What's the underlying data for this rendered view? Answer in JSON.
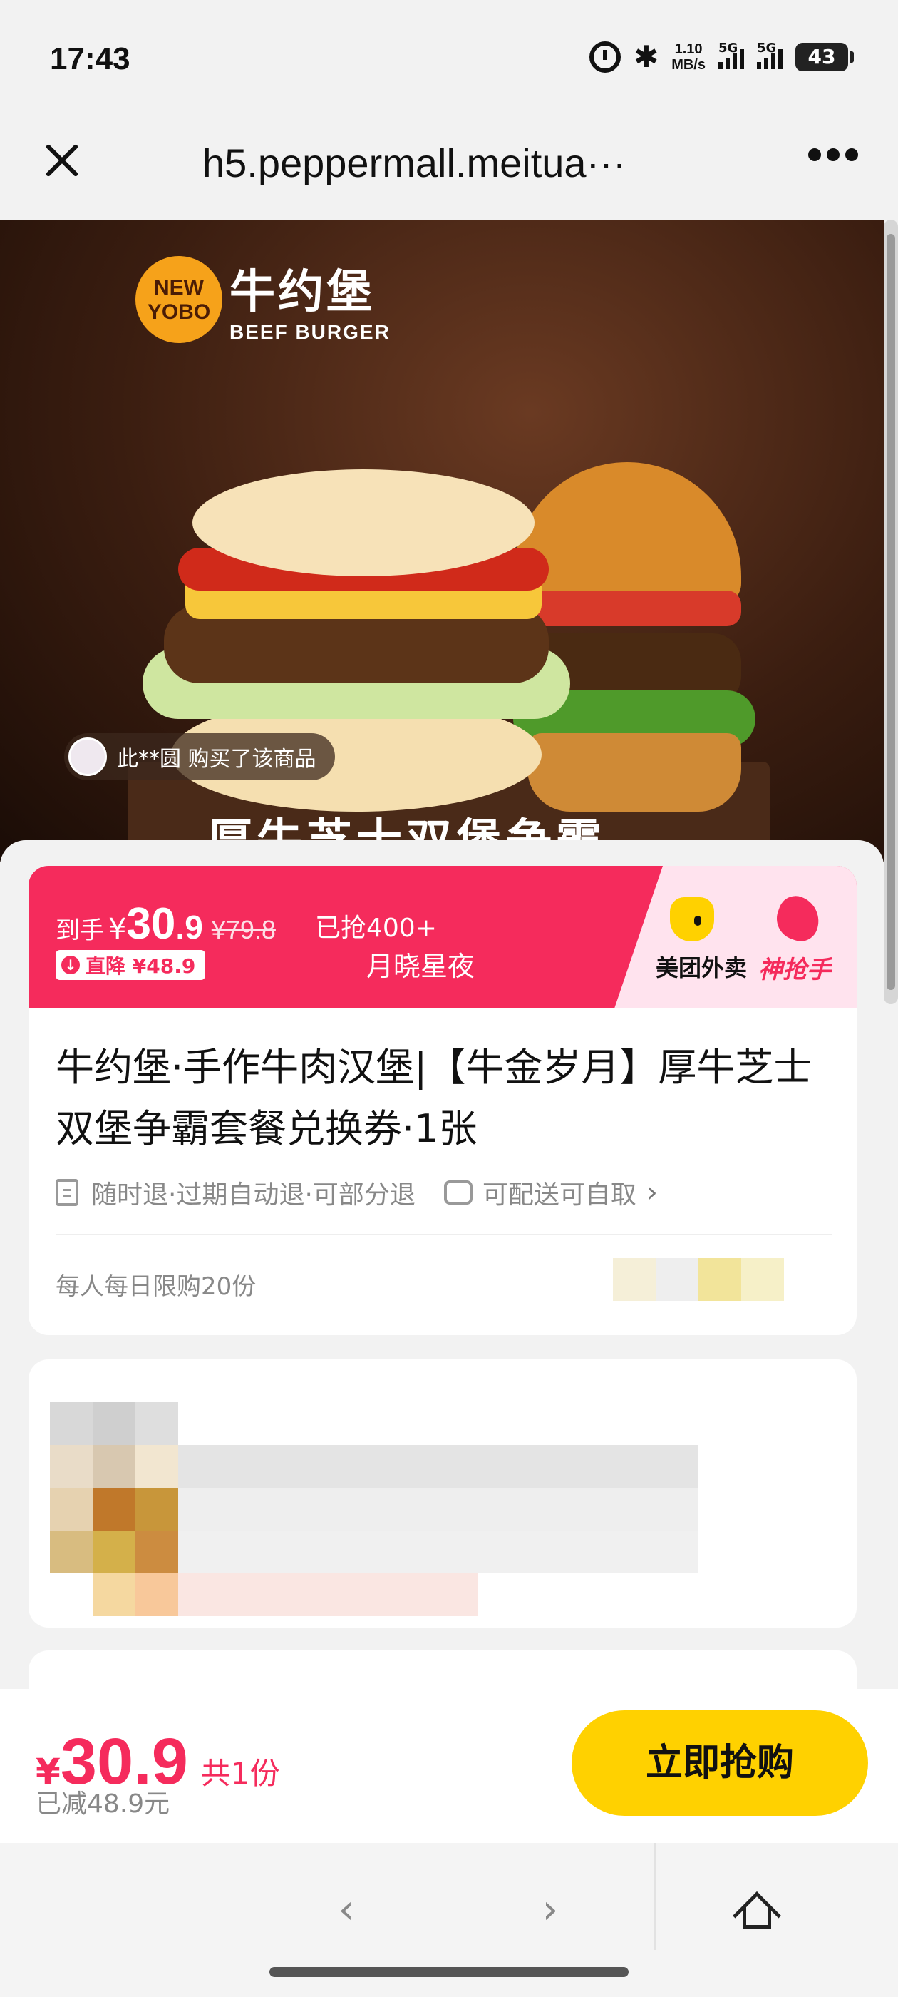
{
  "status_bar": {
    "time": "17:43",
    "net_speed_top": "1.10",
    "net_speed_unit": "MB/s",
    "signal1_label": "5G",
    "signal2_label": "5G",
    "battery": "43"
  },
  "browser": {
    "url": "h5.peppermall.meitua···",
    "close_icon": "close-icon",
    "more_icon": "more-icon"
  },
  "hero": {
    "logo_badge": "NEW YOBO",
    "logo_cn": "牛约堡",
    "logo_en": "BEEF BURGER",
    "buyer_notice": "此**圆 购买了该商品",
    "caption": "厚牛芝士双堡争霸"
  },
  "banner": {
    "price_label": "到手",
    "currency": "¥",
    "price_int": "30",
    "price_dec": ".9",
    "original_price": "¥79.8",
    "sold": "已抢400+",
    "drop_label": "直降 ¥48.9",
    "slogan": "月晓星夜",
    "brand_waimai": "美团外卖",
    "brand_shenqiangshou": "神抢手"
  },
  "product": {
    "title": "牛约堡·手作牛肉汉堡|【牛金岁月】厚牛芝士双堡争霸套餐兑换券·1张",
    "refund_policy": "随时退·过期自动退·可部分退",
    "delivery": "可配送可自取",
    "limit": "每人每日限购20份"
  },
  "footer": {
    "currency": "¥",
    "price": "30.9",
    "qty": "共1份",
    "saved": "已减48.9元",
    "buy_label": "立即抢购"
  },
  "nav": {
    "back": "‹",
    "forward": "›"
  },
  "colors": {
    "accent_red": "#f52b5c",
    "buy_yellow": "#ffd100"
  }
}
